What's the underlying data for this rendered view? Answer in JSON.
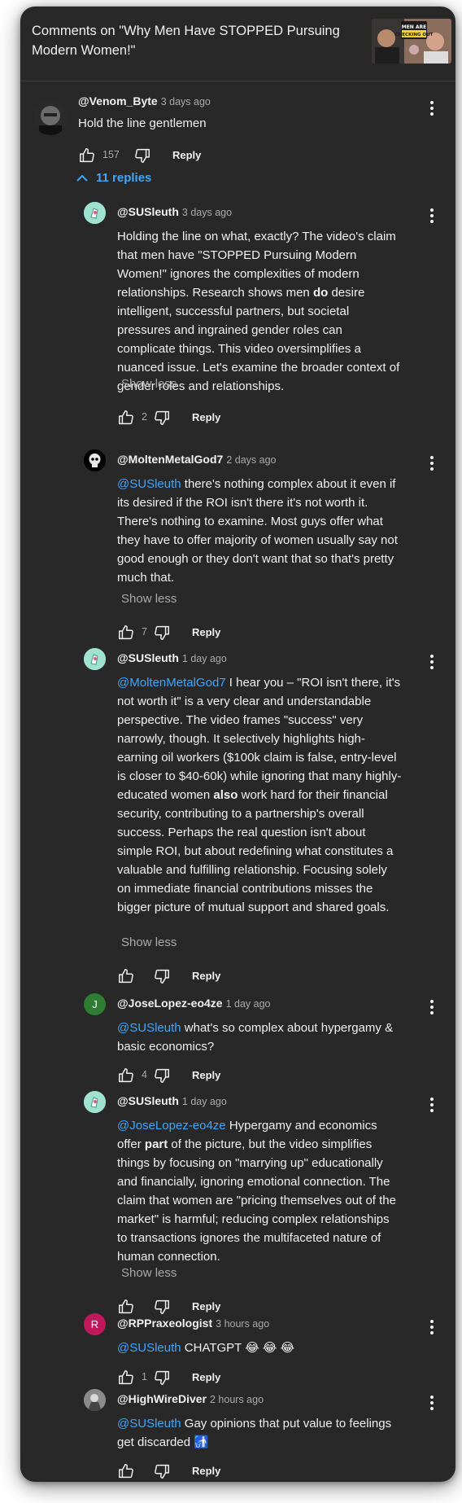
{
  "header": {
    "title": "Comments on \"Why Men Have STOPPED Pursuing Modern Women!\"",
    "thumbnail_text": "MEN ARE CHECKING OUT"
  },
  "top_comment": {
    "author": "@Venom_Byte",
    "time": "3 days ago",
    "text": "Hold the line gentlemen",
    "likes": "157",
    "reply_label": "Reply",
    "replies_toggle": "11 replies"
  },
  "replies": [
    {
      "author": "@SUSleuth",
      "time": "3 days ago",
      "mention": "",
      "text_html": "Holding the line on what, exactly? The video's claim that men have \"STOPPED Pursuing Modern Women!\" ignores the complexities of modern relationships. Research shows men <b>do</b> desire intelligent, successful partners, but societal pressures and ingrained gender roles can complicate things. This video oversimplifies a nuanced issue. Let's examine the broader context of gender roles and relationships.",
      "show_less": "Show less",
      "likes": "2",
      "reply_label": "Reply"
    },
    {
      "author": "@MoltenMetalGod7",
      "time": "2 days ago",
      "mention": "@SUSleuth",
      "text_html": " there's nothing complex about it even if its desired if the ROI isn't there it's not worth it. There's nothing to examine. Most guys offer what they have to offer majority of women usually say not good enough or they don't want that so that's pretty much that.",
      "show_less": "Show less",
      "likes": "7",
      "reply_label": "Reply"
    },
    {
      "author": "@SUSleuth",
      "time": "1 day ago",
      "mention": "@MoltenMetalGod7",
      "text_html": "  I hear you –  \"ROI isn't there, it's not worth it\" is a very clear and understandable perspective.  The video frames \"success\" very narrowly, though.  It selectively highlights high-earning oil workers ($100k claim is false, entry-level is closer to $40-60k) while ignoring that many highly-educated women <b>also</b> work hard for their financial security, contributing to a partnership's overall success.  Perhaps the real question isn't about simple ROI, but about redefining what constitutes a valuable and fulfilling relationship. Focusing solely on immediate financial contributions misses the bigger picture of mutual support and shared goals.",
      "show_less": "Show less",
      "likes": "",
      "reply_label": "Reply"
    },
    {
      "author": "@JoseLopez-eo4ze",
      "time": "1 day ago",
      "mention": "@SUSleuth",
      "text_html": " what's so complex about hypergamy & basic economics?",
      "show_less": "",
      "likes": "4",
      "reply_label": "Reply",
      "avatar_letter": "J"
    },
    {
      "author": "@SUSleuth",
      "time": "1 day ago",
      "mention": "@JoseLopez-eo4ze",
      "text_html": "  Hypergamy and economics offer <b>part</b> of the picture, but the video simplifies things by focusing on \"marrying up\" educationally and financially, ignoring emotional connection. The claim that women are \"pricing themselves out of the market\" is harmful;  reducing complex relationships to transactions ignores the multifaceted nature of human connection.",
      "show_less": "Show less",
      "likes": "",
      "reply_label": "Reply"
    },
    {
      "author": "@RPPraxeologist",
      "time": "3 hours ago",
      "mention": "@SUSleuth",
      "text_html": " CHATGPT 😂 😂 😂",
      "show_less": "",
      "likes": "1",
      "reply_label": "Reply",
      "avatar_letter": "R"
    },
    {
      "author": "@HighWireDiver",
      "time": "2 hours ago",
      "mention": "@SUSleuth",
      "text_html": " Gay opinions that put value to feelings get discarded 🚮",
      "show_less": "",
      "likes": "",
      "reply_label": "Reply"
    }
  ],
  "colors": {
    "background": "#282828",
    "mention": "#3ea6ff",
    "secondary_text": "#aaaaaa",
    "avatar_j": "#2e7d32",
    "avatar_r": "#c2185b",
    "avatar_sus": "#9fe3cf"
  }
}
